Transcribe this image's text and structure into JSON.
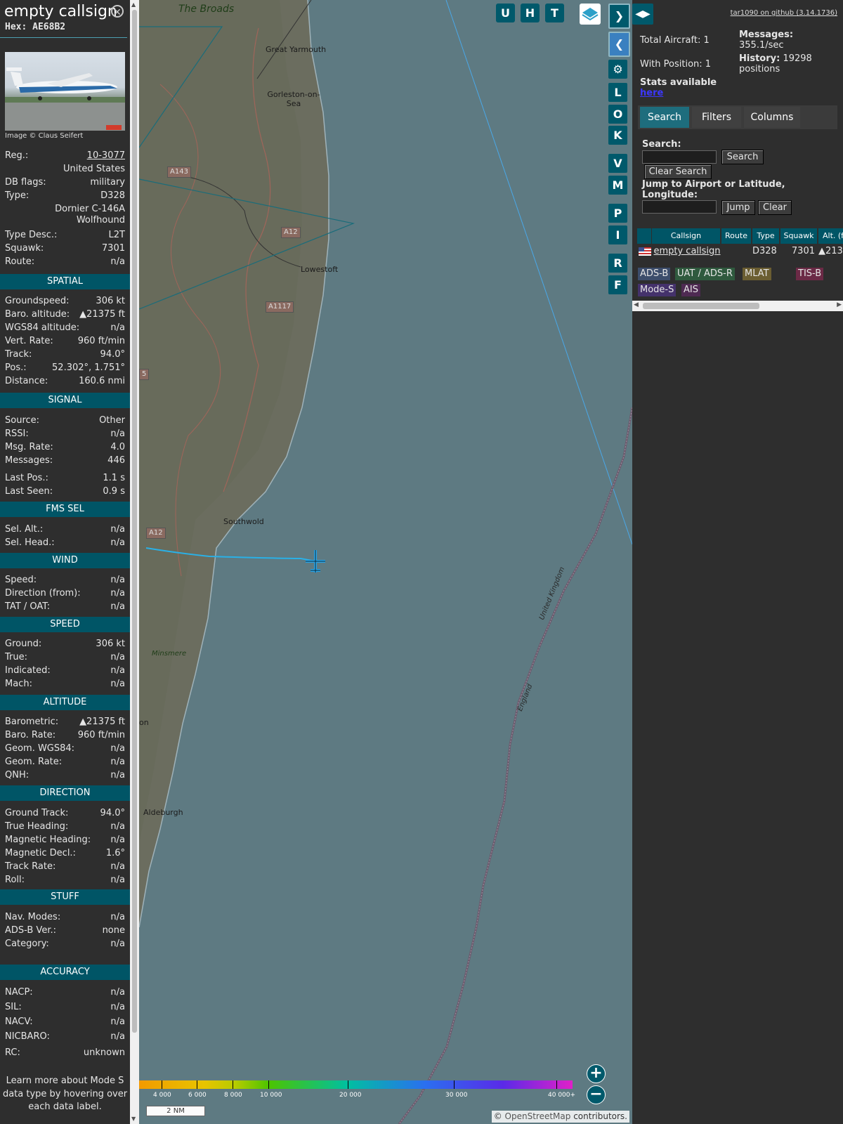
{
  "infoblock": {
    "callsign": "empty callsign",
    "hex": "Hex: AE68B2",
    "photo_credit": "Image © Claus Seifert",
    "rows_top": [
      {
        "k": "Reg.:",
        "v": "10-3077"
      },
      {
        "k": "",
        "v": "United States"
      },
      {
        "k": "DB flags:",
        "v": "military"
      },
      {
        "k": "Type:",
        "v": "D328"
      },
      {
        "k": "",
        "v": "Dornier C-146A Wolfhound"
      },
      {
        "k": "Type Desc.:",
        "v": "L2T"
      },
      {
        "k": "Squawk:",
        "v": "7301"
      },
      {
        "k": "Route:",
        "v": "n/a"
      }
    ],
    "sections": [
      {
        "title": "SPATIAL",
        "rows": [
          {
            "k": "Groundspeed:",
            "v": "306 kt"
          },
          {
            "k": "Baro. altitude:",
            "v": "▲21375 ft"
          },
          {
            "k": "WGS84 altitude:",
            "v": "n/a"
          },
          {
            "k": "Vert. Rate:",
            "v": "960 ft/min"
          },
          {
            "k": "Track:",
            "v": "94.0°"
          },
          {
            "k": "Pos.:",
            "v": "52.302°, 1.751°"
          },
          {
            "k": "Distance:",
            "v": "160.6 nmi"
          }
        ]
      },
      {
        "title": "SIGNAL",
        "rows": [
          {
            "k": "Source:",
            "v": "Other"
          },
          {
            "k": "RSSI:",
            "v": "n/a"
          },
          {
            "k": "Msg. Rate:",
            "v": "4.0"
          },
          {
            "k": "Messages:",
            "v": "446"
          },
          {
            "k": "Last Pos.:",
            "v": "1.1 s"
          },
          {
            "k": "Last Seen:",
            "v": "0.9 s"
          }
        ]
      },
      {
        "title": "FMS SEL",
        "rows": [
          {
            "k": "Sel. Alt.:",
            "v": "n/a"
          },
          {
            "k": "Sel. Head.:",
            "v": "n/a"
          }
        ]
      },
      {
        "title": "WIND",
        "rows": [
          {
            "k": "Speed:",
            "v": "n/a"
          },
          {
            "k": "Direction (from):",
            "v": "n/a"
          },
          {
            "k": "TAT / OAT:",
            "v": "n/a"
          }
        ]
      },
      {
        "title": "SPEED",
        "rows": [
          {
            "k": "Ground:",
            "v": "306 kt"
          },
          {
            "k": "True:",
            "v": "n/a"
          },
          {
            "k": "Indicated:",
            "v": "n/a"
          },
          {
            "k": "Mach:",
            "v": "n/a"
          }
        ]
      },
      {
        "title": "ALTITUDE",
        "rows": [
          {
            "k": "Barometric:",
            "v": "▲21375 ft"
          },
          {
            "k": "Baro. Rate:",
            "v": "960 ft/min"
          },
          {
            "k": "Geom. WGS84:",
            "v": "n/a"
          },
          {
            "k": "Geom. Rate:",
            "v": "n/a"
          },
          {
            "k": "QNH:",
            "v": "n/a"
          }
        ]
      },
      {
        "title": "DIRECTION",
        "rows": [
          {
            "k": "Ground Track:",
            "v": "94.0°"
          },
          {
            "k": "True Heading:",
            "v": "n/a"
          },
          {
            "k": "Magnetic Heading:",
            "v": "n/a"
          },
          {
            "k": "Magnetic Decl.:",
            "v": "1.6°"
          },
          {
            "k": "Track Rate:",
            "v": "n/a"
          },
          {
            "k": "Roll:",
            "v": "n/a"
          }
        ]
      },
      {
        "title": "STUFF",
        "rows": [
          {
            "k": "Nav. Modes:",
            "v": "n/a"
          },
          {
            "k": "ADS-B Ver.:",
            "v": "none"
          },
          {
            "k": "Category:",
            "v": "n/a"
          }
        ]
      },
      {
        "title": "ACCURACY",
        "rows": [
          {
            "k": "NACP:",
            "v": "n/a"
          },
          {
            "k": "SIL:",
            "v": "n/a"
          },
          {
            "k": "NACV:",
            "v": "n/a"
          },
          {
            "k": "NICBARO:",
            "v": "n/a"
          },
          {
            "k": "RC:",
            "v": "unknown"
          }
        ]
      }
    ],
    "footer": "Learn more about Mode S data type by hovering over each data label."
  },
  "map": {
    "places": [
      "Great Yarmouth",
      "Gorleston-on-Sea",
      "Lowestoft",
      "Southwold",
      "Aldeburgh",
      "Minsmere",
      "on"
    ],
    "area_label": "The Broads",
    "roads": [
      "A143",
      "A12",
      "A1117",
      "A12",
      "5"
    ],
    "border_labels": [
      "United Kingdom",
      "England"
    ],
    "top_buttons": [
      "U",
      "H",
      "T"
    ],
    "side_buttons": [
      "L",
      "O",
      "K",
      "V",
      "M",
      "P",
      "I",
      "R",
      "F"
    ],
    "legend_ticks": [
      "4 000",
      "6 000",
      "8 000",
      "10 000",
      "20 000",
      "30 000",
      "40 000+"
    ],
    "scale": "2 NM",
    "attribution_prefix": "© ",
    "attribution_link": "OpenStreetMap",
    "attribution_suffix": " contributors."
  },
  "right": {
    "github": "tar1090 on github (3.14.1736)",
    "total_aircraft": "Total Aircraft: 1",
    "with_position": "With Position: 1",
    "messages_label": "Messages:",
    "messages_value": "355.1/sec",
    "history_label": "History:",
    "history_value": "19298 positions",
    "stats_label": "Stats available",
    "stats_link": "here",
    "tabs": [
      "Search",
      "Filters",
      "Columns"
    ],
    "search_label": "Search:",
    "search_button": "Search",
    "clear_search_button": "Clear Search",
    "jump_label": "Jump to Airport or Latitude, Longitude:",
    "jump_button": "Jump",
    "clear_button": "Clear",
    "columns": [
      "Callsign",
      "Route",
      "Type",
      "Squawk",
      "Alt. (ft)"
    ],
    "row": {
      "callsign": "empty callsign",
      "route": "",
      "type": "D328",
      "squawk": "7301",
      "alt": "▲213"
    },
    "badges": [
      {
        "label": "ADS-B",
        "bg": "#3c4d6b",
        "fg": "#e6e6e6"
      },
      {
        "label": "UAT / ADS-R",
        "bg": "#2f5a3e",
        "fg": "#e6e6e6"
      },
      {
        "label": "MLAT",
        "bg": "#6b5e32",
        "fg": "#e6e6e6"
      },
      {
        "label": "TIS-B",
        "bg": "#6b2a46",
        "fg": "#e6e6e6"
      },
      {
        "label": "Mode-S",
        "bg": "#44326b",
        "fg": "#e6e6e6"
      },
      {
        "label": "AIS",
        "bg": "#4e2a52",
        "fg": "#e6e6e6"
      }
    ]
  }
}
